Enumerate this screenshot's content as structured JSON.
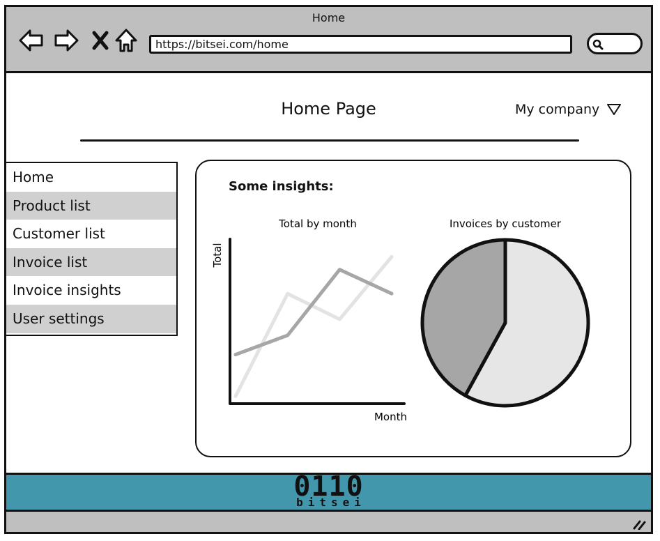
{
  "window": {
    "title": "Home"
  },
  "browser": {
    "url": "https://bitsei.com/home",
    "icons": [
      "arrow-left-icon",
      "arrow-right-icon",
      "close-icon",
      "home-icon",
      "search-icon"
    ]
  },
  "header": {
    "title": "Home Page",
    "company": "My company"
  },
  "sidebar": {
    "items": [
      {
        "label": "Home"
      },
      {
        "label": "Product list"
      },
      {
        "label": "Customer list"
      },
      {
        "label": "Invoice list"
      },
      {
        "label": "Invoice insights"
      },
      {
        "label": "User settings"
      }
    ]
  },
  "insights": {
    "title": "Some insights:"
  },
  "chart_data": [
    {
      "type": "line",
      "title": "Total by month",
      "xlabel": "Month",
      "ylabel": "Total",
      "x": [
        0,
        1,
        2,
        3
      ],
      "ylim": [
        0,
        100
      ],
      "series": [
        {
          "values": [
            28,
            40,
            81,
            66
          ],
          "color": "#a6a6a6"
        },
        {
          "values": [
            2,
            66,
            50,
            89
          ],
          "color": "#e3e3e3"
        }
      ]
    },
    {
      "type": "pie",
      "title": "Invoices by customer",
      "slices": [
        {
          "value": 58,
          "color": "#e6e6e6"
        },
        {
          "value": 42,
          "color": "#a6a6a6"
        }
      ]
    }
  ],
  "footer": {
    "logo_number": "0110",
    "logo_text": "bitsei"
  },
  "colors": {
    "chrome": "#bfbfbf",
    "footer": "#4297ad",
    "sidebar_alt": "#d0d0d0"
  }
}
